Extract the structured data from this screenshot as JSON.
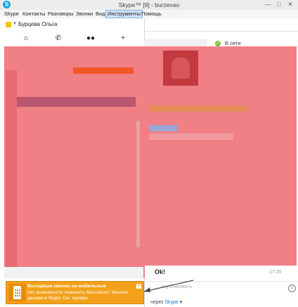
{
  "window": {
    "title": "Skype™ [9] - burzevao",
    "icon_letter": "S",
    "minimize": "—",
    "maximize": "□",
    "close": "✕"
  },
  "menu": [
    "Skype",
    "Контакты",
    "Разговоры",
    "Звонки",
    "Вид",
    "Инструменты",
    "Помощь"
  ],
  "profile": {
    "name": "Бурцева Ольга"
  },
  "nav": {
    "home_icon": "home-icon",
    "call_icon": "phone-icon",
    "contacts_icon": "contacts-icon",
    "add_icon": "add-contact-icon"
  },
  "status": {
    "label": "В сети"
  },
  "chat": {
    "last_message": "Ok!",
    "time": "17:35",
    "input_placeholder": "…опубликовать",
    "via_prefix": "через",
    "via_link": "Skype"
  },
  "promo": {
    "title": "Выгодные звонки на мобильные",
    "text": "Нет возможности позвонить бесплатно? Звоните дешево в Skype. См. тарифы"
  },
  "colors": {
    "promo": "#f3a11b",
    "accent": "#1ba1e2",
    "blur": "#f07f86",
    "online": "#7cc242"
  }
}
